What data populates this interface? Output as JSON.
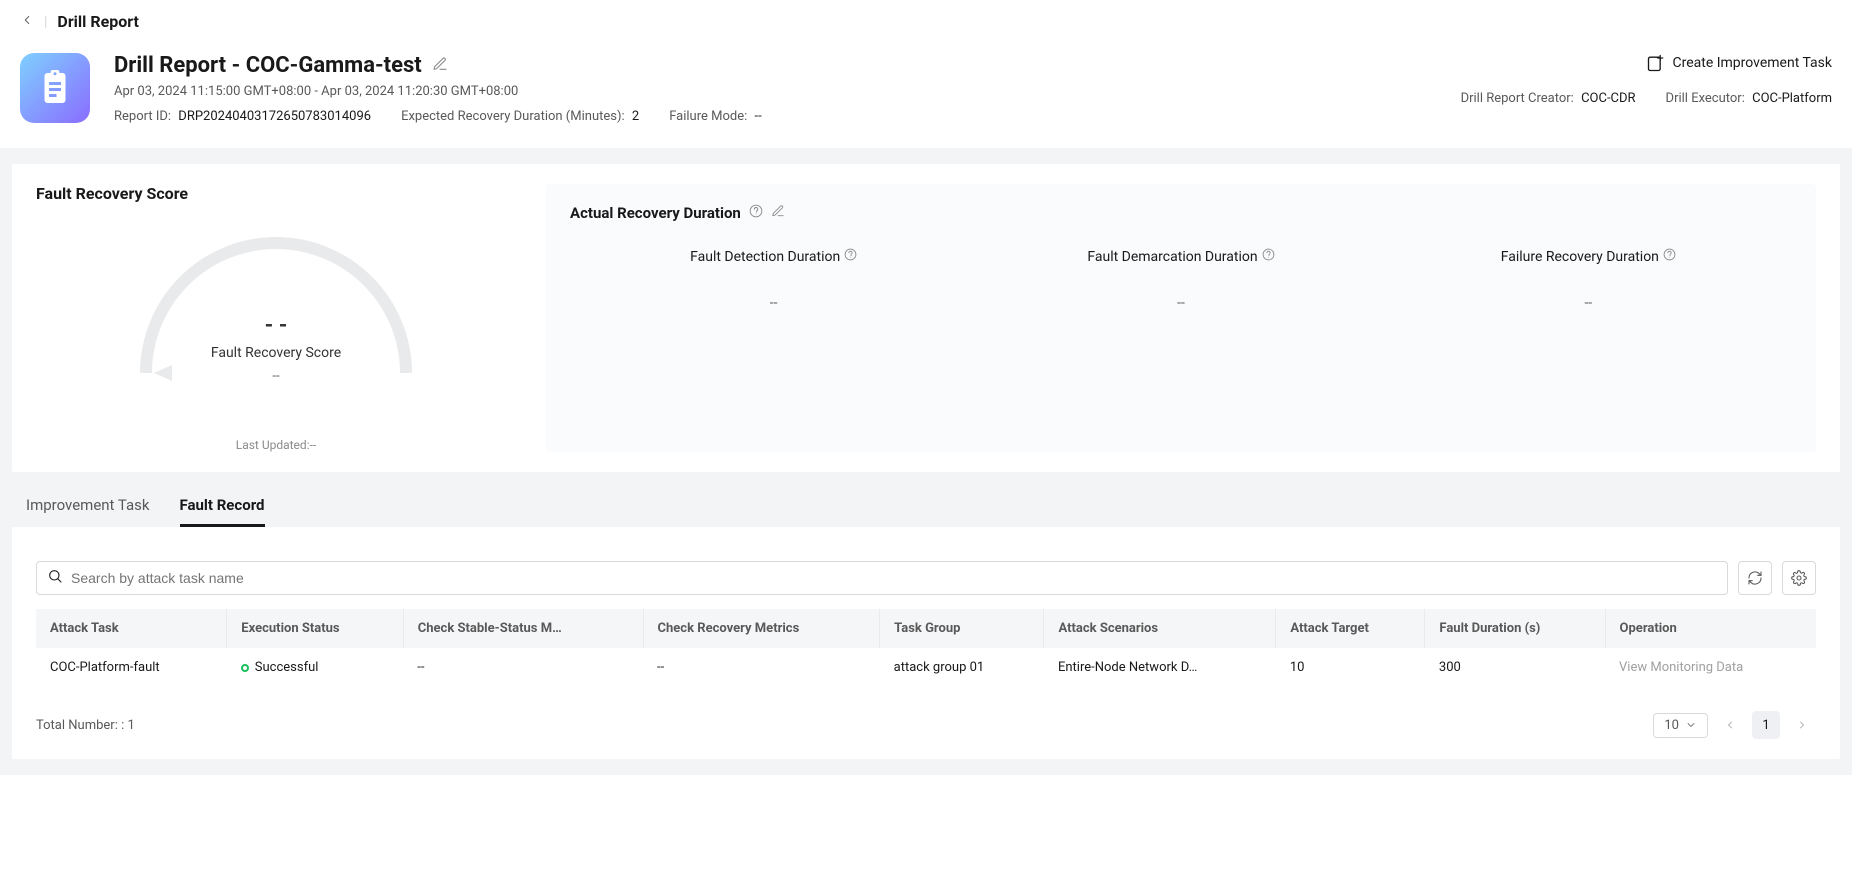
{
  "breadcrumb": "Drill Report",
  "header": {
    "title": "Drill Report - COC-Gamma-test",
    "time_range": "Apr 03, 2024 11:15:00 GMT+08:00 - Apr 03, 2024 11:20:30 GMT+08:00",
    "report_id_label": "Report ID:",
    "report_id": "DRP20240403172650783014096",
    "expected_label": "Expected Recovery Duration (Minutes):",
    "expected_value": "2",
    "failure_mode_label": "Failure Mode:",
    "failure_mode_value": "--",
    "create_task_label": "Create Improvement Task",
    "creator_label": "Drill Report Creator:",
    "creator_value": "COC-CDR",
    "executor_label": "Drill Executor:",
    "executor_value": "COC-Platform"
  },
  "score_section": {
    "heading": "Fault Recovery Score",
    "value": "- -",
    "label": "Fault Recovery Score",
    "sub": "--",
    "updated_label": "Last Updated:",
    "updated_value": "--"
  },
  "duration_section": {
    "title": "Actual Recovery Duration",
    "items": [
      {
        "label": "Fault Detection Duration",
        "value": "--"
      },
      {
        "label": "Fault Demarcation Duration",
        "value": "--"
      },
      {
        "label": "Failure Recovery Duration",
        "value": "--"
      }
    ]
  },
  "tabs": {
    "improvement": "Improvement Task",
    "fault_record": "Fault Record"
  },
  "search": {
    "placeholder": "Search by attack task name"
  },
  "table": {
    "columns": {
      "attack_task": "Attack Task",
      "execution_status": "Execution Status",
      "check_stable": "Check Stable-Status M…",
      "check_recovery": "Check Recovery Metrics",
      "task_group": "Task Group",
      "attack_scenarios": "Attack Scenarios",
      "attack_target": "Attack Target",
      "fault_duration": "Fault Duration (s)",
      "operation": "Operation"
    },
    "rows": [
      {
        "attack_task": "COC-Platform-fault",
        "execution_status": "Successful",
        "check_stable": "--",
        "check_recovery": "--",
        "task_group": "attack group 01",
        "attack_scenarios": "Entire-Node Network D…",
        "attack_target": "10",
        "fault_duration": "300",
        "operation": "View Monitoring Data"
      }
    ]
  },
  "footer": {
    "total_label": "Total Number: :",
    "total_value": "1",
    "page_size": "10",
    "current_page": "1"
  }
}
